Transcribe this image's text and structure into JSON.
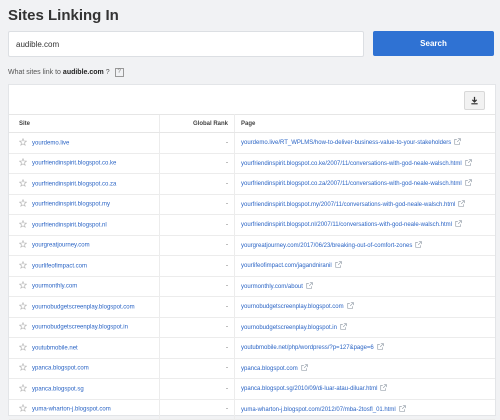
{
  "header": {
    "title": "Sites Linking In"
  },
  "search": {
    "value": "audible.com",
    "button_label": "Search"
  },
  "question": {
    "prefix": "What sites link to ",
    "domain": "audible.com",
    "suffix": "?",
    "help": "?"
  },
  "table": {
    "columns": {
      "site": "Site",
      "rank": "Global Rank",
      "page": "Page"
    },
    "rows": [
      {
        "site": "yourdemo.live",
        "rank": "-",
        "page": "yourdemo.live/RT_WPLMS/how-to-deliver-business-value-to-your-stakeholders"
      },
      {
        "site": "yourfriendinspirit.blogspot.co.ke",
        "rank": "-",
        "page": "yourfriendinspirit.blogspot.co.ke/2007/11/conversations-with-god-neale-walsch.html"
      },
      {
        "site": "yourfriendinspirit.blogspot.co.za",
        "rank": "-",
        "page": "yourfriendinspirit.blogspot.co.za/2007/11/conversations-with-god-neale-walsch.html"
      },
      {
        "site": "yourfriendinspirit.blogspot.my",
        "rank": "-",
        "page": "yourfriendinspirit.blogspot.my/2007/11/conversations-with-god-neale-walsch.html"
      },
      {
        "site": "yourfriendinspirit.blogspot.nl",
        "rank": "-",
        "page": "yourfriendinspirit.blogspot.nl/2007/11/conversations-with-god-neale-walsch.html"
      },
      {
        "site": "yourgreatjourney.com",
        "rank": "-",
        "page": "yourgreatjourney.com/2017/06/23/breaking-out-of-comfort-zones"
      },
      {
        "site": "yourlifeofimpact.com",
        "rank": "-",
        "page": "yourlifeofimpact.com/jagandniranil"
      },
      {
        "site": "yourmonthly.com",
        "rank": "-",
        "page": "yourmonthly.com/about"
      },
      {
        "site": "yournobudgetscreenplay.blogspot.com",
        "rank": "-",
        "page": "yournobudgetscreenplay.blogspot.com"
      },
      {
        "site": "yournobudgetscreenplay.blogspot.in",
        "rank": "-",
        "page": "yournobudgetscreenplay.blogspot.in"
      },
      {
        "site": "youtubmobile.net",
        "rank": "-",
        "page": "youtubmobile.net/php/wordpress/?p=127&page=6"
      },
      {
        "site": "ypanca.blogspot.com",
        "rank": "-",
        "page": "ypanca.blogspot.com"
      },
      {
        "site": "ypanca.blogspot.sg",
        "rank": "-",
        "page": "ypanca.blogspot.sg/2010/09/di-luar-atau-diluar.html"
      },
      {
        "site": "yuma-wharton-j.blogspot.com",
        "rank": "-",
        "page": "yuma-wharton-j.blogspot.com/2012/07/mba-2tosfl_01.html"
      }
    ]
  },
  "colors": {
    "accent": "#2f72d3",
    "link": "#2a64c5",
    "background": "#f1f2f4"
  },
  "icons": {
    "star": "star-icon",
    "external": "external-link-icon",
    "download": "download-icon",
    "help": "help-icon"
  }
}
